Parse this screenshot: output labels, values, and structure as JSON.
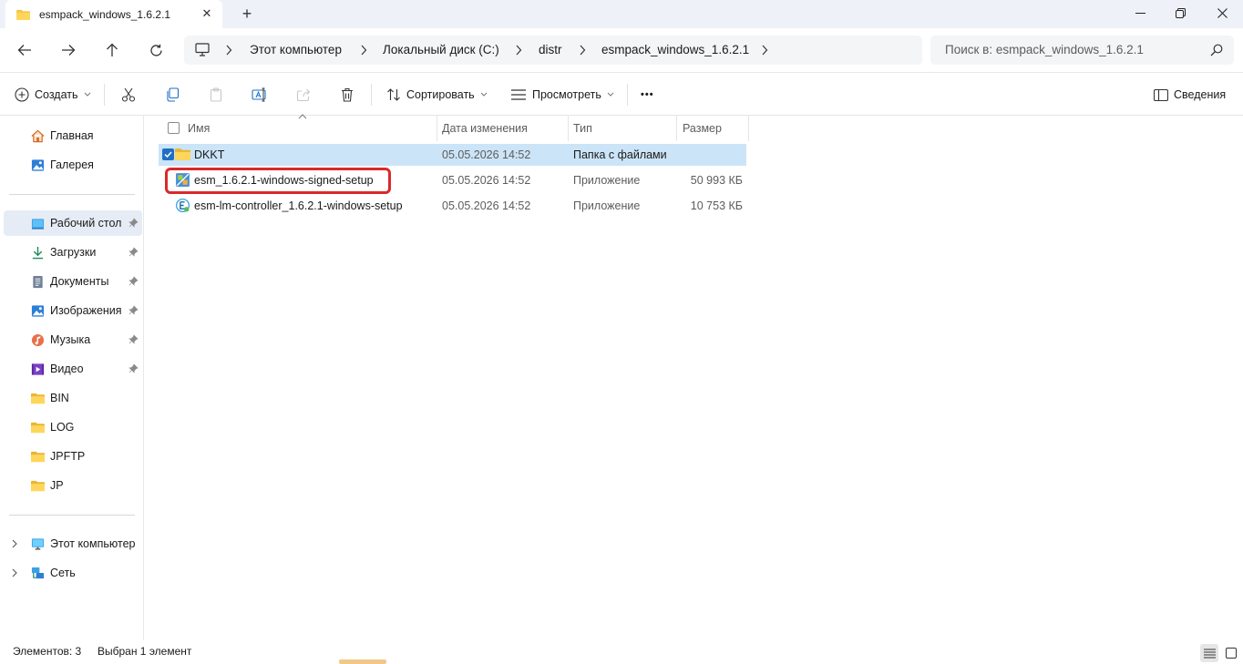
{
  "window": {
    "tab_title": "esmpack_windows_1.6.2.1",
    "icons": {
      "minimize": "minimize-icon",
      "maximize": "restore-icon",
      "close": "close-icon",
      "new_tab": "plus-icon"
    }
  },
  "nav": {
    "breadcrumbs": [
      "Этот компьютер",
      "Локальный диск (C:)",
      "distr",
      "esmpack_windows_1.6.2.1"
    ],
    "search_placeholder": "Поиск в: esmpack_windows_1.6.2.1"
  },
  "toolbar": {
    "new_label": "Создать",
    "sort_label": "Сортировать",
    "view_label": "Просмотреть",
    "more_label": "•••",
    "details_label": "Сведения"
  },
  "sidebar": {
    "top_items": [
      {
        "label": "Главная",
        "icon": "home-icon"
      },
      {
        "label": "Галерея",
        "icon": "gallery-icon"
      }
    ],
    "pinned_items": [
      {
        "label": "Рабочий стол",
        "icon": "desktop-icon",
        "pinned": true,
        "selected": true
      },
      {
        "label": "Загрузки",
        "icon": "download-icon",
        "pinned": true
      },
      {
        "label": "Документы",
        "icon": "documents-icon",
        "pinned": true
      },
      {
        "label": "Изображения",
        "icon": "pictures-icon",
        "pinned": true
      },
      {
        "label": "Музыка",
        "icon": "music-icon",
        "pinned": true
      },
      {
        "label": "Видео",
        "icon": "video-icon",
        "pinned": true
      },
      {
        "label": "BIN",
        "icon": "folder-icon"
      },
      {
        "label": "LOG",
        "icon": "folder-icon"
      },
      {
        "label": "JPFTP",
        "icon": "folder-icon"
      },
      {
        "label": "JP",
        "icon": "folder-icon"
      }
    ],
    "bottom_items": [
      {
        "label": "Этот компьютер",
        "icon": "computer-icon"
      },
      {
        "label": "Сеть",
        "icon": "network-icon"
      }
    ]
  },
  "filelist": {
    "columns": [
      "Имя",
      "Дата изменения",
      "Тип",
      "Размер"
    ],
    "rows": [
      {
        "name": "DKKT",
        "date": "05.05.2026 14:52",
        "type": "Папка с файлами",
        "size": "",
        "icon": "folder-icon",
        "selected": true
      },
      {
        "name": "esm_1.6.2.1-windows-signed-setup",
        "date": "05.05.2026 14:52",
        "type": "Приложение",
        "size": "50 993 КБ",
        "icon": "installer-icon",
        "highlighted": true
      },
      {
        "name": "esm-lm-controller_1.6.2.1-windows-setup",
        "date": "05.05.2026 14:52",
        "type": "Приложение",
        "size": "10 753 КБ",
        "icon": "app-setup-icon"
      }
    ]
  },
  "status": {
    "item_count": "Элементов: 3",
    "selected_count": "Выбран 1 элемент"
  },
  "colors": {
    "accent": "#1f6fc5",
    "selection": "#cce4f7",
    "highlight_border": "#d9292b",
    "folder": "#f4c542"
  }
}
